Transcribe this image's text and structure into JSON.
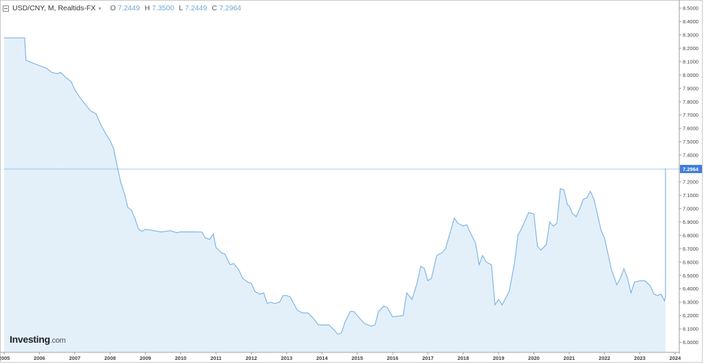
{
  "header": {
    "symbol": "USD/CNY, M, Realtids-FX",
    "dropdown_icon": "chevron-down-icon",
    "open_key": "O",
    "open_val": "7.2449",
    "high_key": "H",
    "high_val": "7.3500",
    "low_key": "L",
    "low_val": "7.2449",
    "close_key": "C",
    "close_val": "7.2964"
  },
  "logo": {
    "brand": "Investing",
    "suffix": ".com"
  },
  "colors": {
    "line": "#7fb4e6",
    "fill": "#e3f0fa",
    "price_line": "#5b9ad6",
    "price_label_bg": "#3f7fd8"
  },
  "chart_data": {
    "type": "area",
    "x_unit": "year",
    "xlim": [
      2005.0,
      2024.0
    ],
    "ylim": [
      5.93,
      8.53
    ],
    "y_ticks": [
      "8.5000",
      "8.4000",
      "8.3000",
      "8.2000",
      "8.1000",
      "8.0000",
      "7.9000",
      "7.8000",
      "7.7000",
      "7.6000",
      "7.5000",
      "7.4000",
      "7.3000",
      "7.2000",
      "7.1000",
      "7.0000",
      "6.9000",
      "6.8000",
      "6.7000",
      "6.6000",
      "6.5000",
      "6.4000",
      "6.3000",
      "6.2000",
      "6.1000",
      "6.0000"
    ],
    "x_ticks": [
      "2005",
      "2006",
      "2007",
      "2008",
      "2009",
      "2010",
      "2011",
      "2012",
      "2013",
      "2014",
      "2015",
      "2016",
      "2017",
      "2018",
      "2019",
      "2020",
      "2021",
      "2022",
      "2023",
      "2024"
    ],
    "last_price": "7.2964",
    "last_price_value": 7.2964,
    "points": [
      [
        2005.0,
        8.277
      ],
      [
        2005.58,
        8.277
      ],
      [
        2005.62,
        8.11
      ],
      [
        2005.8,
        8.09
      ],
      [
        2006.0,
        8.07
      ],
      [
        2006.2,
        8.05
      ],
      [
        2006.35,
        8.02
      ],
      [
        2006.5,
        8.01
      ],
      [
        2006.6,
        8.02
      ],
      [
        2006.75,
        7.98
      ],
      [
        2006.9,
        7.95
      ],
      [
        2007.0,
        7.89
      ],
      [
        2007.15,
        7.83
      ],
      [
        2007.3,
        7.78
      ],
      [
        2007.45,
        7.73
      ],
      [
        2007.6,
        7.71
      ],
      [
        2007.75,
        7.62
      ],
      [
        2007.9,
        7.55
      ],
      [
        2008.0,
        7.51
      ],
      [
        2008.1,
        7.45
      ],
      [
        2008.2,
        7.32
      ],
      [
        2008.3,
        7.2
      ],
      [
        2008.42,
        7.1
      ],
      [
        2008.5,
        7.01
      ],
      [
        2008.6,
        6.99
      ],
      [
        2008.7,
        6.93
      ],
      [
        2008.8,
        6.85
      ],
      [
        2008.9,
        6.83
      ],
      [
        2009.0,
        6.845
      ],
      [
        2009.25,
        6.835
      ],
      [
        2009.45,
        6.825
      ],
      [
        2009.7,
        6.835
      ],
      [
        2009.9,
        6.82
      ],
      [
        2010.0,
        6.826
      ],
      [
        2010.25,
        6.826
      ],
      [
        2010.4,
        6.826
      ],
      [
        2010.6,
        6.825
      ],
      [
        2010.7,
        6.78
      ],
      [
        2010.82,
        6.77
      ],
      [
        2010.92,
        6.81
      ],
      [
        2011.0,
        6.71
      ],
      [
        2011.15,
        6.67
      ],
      [
        2011.25,
        6.66
      ],
      [
        2011.4,
        6.58
      ],
      [
        2011.5,
        6.59
      ],
      [
        2011.65,
        6.54
      ],
      [
        2011.75,
        6.48
      ],
      [
        2011.9,
        6.45
      ],
      [
        2012.0,
        6.44
      ],
      [
        2012.1,
        6.38
      ],
      [
        2012.25,
        6.36
      ],
      [
        2012.35,
        6.37
      ],
      [
        2012.45,
        6.29
      ],
      [
        2012.55,
        6.3
      ],
      [
        2012.65,
        6.29
      ],
      [
        2012.8,
        6.3
      ],
      [
        2012.9,
        6.35
      ],
      [
        2013.0,
        6.35
      ],
      [
        2013.1,
        6.34
      ],
      [
        2013.3,
        6.24
      ],
      [
        2013.45,
        6.22
      ],
      [
        2013.6,
        6.22
      ],
      [
        2013.75,
        6.18
      ],
      [
        2013.9,
        6.13
      ],
      [
        2014.0,
        6.13
      ],
      [
        2014.2,
        6.13
      ],
      [
        2014.35,
        6.09
      ],
      [
        2014.45,
        6.06
      ],
      [
        2014.55,
        6.07
      ],
      [
        2014.65,
        6.15
      ],
      [
        2014.8,
        6.23
      ],
      [
        2014.9,
        6.23
      ],
      [
        2015.0,
        6.2
      ],
      [
        2015.2,
        6.14
      ],
      [
        2015.4,
        6.12
      ],
      [
        2015.5,
        6.13
      ],
      [
        2015.6,
        6.23
      ],
      [
        2015.75,
        6.27
      ],
      [
        2015.85,
        6.26
      ],
      [
        2016.0,
        6.19
      ],
      [
        2016.3,
        6.2
      ],
      [
        2016.4,
        6.37
      ],
      [
        2016.55,
        6.32
      ],
      [
        2016.7,
        6.45
      ],
      [
        2016.8,
        6.57
      ],
      [
        2016.9,
        6.55
      ],
      [
        2017.0,
        6.46
      ],
      [
        2017.1,
        6.48
      ],
      [
        2017.25,
        6.65
      ],
      [
        2017.4,
        6.67
      ],
      [
        2017.5,
        6.7
      ],
      [
        2017.65,
        6.84
      ],
      [
        2017.75,
        6.93
      ],
      [
        2017.85,
        6.89
      ],
      [
        2018.0,
        6.87
      ],
      [
        2018.1,
        6.88
      ],
      [
        2018.2,
        6.82
      ],
      [
        2018.35,
        6.74
      ],
      [
        2018.45,
        6.58
      ],
      [
        2018.55,
        6.65
      ],
      [
        2018.65,
        6.6
      ],
      [
        2018.8,
        6.58
      ],
      [
        2018.9,
        6.28
      ],
      [
        2019.0,
        6.32
      ],
      [
        2019.1,
        6.28
      ],
      [
        2019.3,
        6.38
      ],
      [
        2019.45,
        6.59
      ],
      [
        2019.55,
        6.8
      ],
      [
        2019.65,
        6.85
      ],
      [
        2019.75,
        6.91
      ],
      [
        2019.85,
        6.97
      ],
      [
        2020.0,
        6.96
      ],
      [
        2020.1,
        6.72
      ],
      [
        2020.2,
        6.69
      ],
      [
        2020.35,
        6.73
      ],
      [
        2020.45,
        6.9
      ],
      [
        2020.55,
        6.87
      ],
      [
        2020.65,
        6.89
      ],
      [
        2020.75,
        7.15
      ],
      [
        2020.85,
        7.14
      ],
      [
        2020.95,
        7.03
      ],
      [
        2021.0,
        7.02
      ],
      [
        2021.1,
        6.96
      ],
      [
        2021.2,
        6.94
      ],
      [
        2021.3,
        7.0
      ],
      [
        2021.4,
        7.07
      ],
      [
        2021.5,
        7.08
      ],
      [
        2021.6,
        7.13
      ],
      [
        2021.7,
        7.07
      ],
      [
        2021.8,
        6.96
      ],
      [
        2021.9,
        6.84
      ],
      [
        2022.0,
        6.78
      ],
      [
        2022.1,
        6.66
      ],
      [
        2022.2,
        6.54
      ],
      [
        2022.35,
        6.43
      ],
      [
        2022.45,
        6.48
      ],
      [
        2022.55,
        6.55
      ],
      [
        2022.65,
        6.48
      ],
      [
        2022.75,
        6.37
      ],
      [
        2022.85,
        6.45
      ],
      [
        2023.0,
        6.46
      ],
      [
        2023.15,
        6.46
      ],
      [
        2023.3,
        6.42
      ],
      [
        2023.4,
        6.36
      ],
      [
        2023.5,
        6.35
      ],
      [
        2023.6,
        6.36
      ],
      [
        2023.7,
        6.31
      ],
      [
        2023.8,
        6.35
      ],
      [
        2023.85,
        6.61
      ],
      [
        2023.95,
        6.69
      ],
      [
        2024.05,
        6.79
      ],
      [
        2024.15,
        6.96
      ],
      [
        2024.25,
        7.26
      ],
      [
        2024.3,
        7.3
      ],
      [
        2024.4,
        7.0
      ],
      [
        2024.5,
        6.88
      ],
      [
        2024.6,
        6.75
      ],
      [
        2024.7,
        6.94
      ],
      [
        2024.8,
        6.88
      ],
      [
        2024.9,
        6.94
      ],
      [
        2025.0,
        7.1
      ],
      [
        2025.1,
        7.27
      ],
      [
        2025.2,
        7.14
      ],
      [
        2025.3,
        7.24
      ],
      [
        2025.35,
        7.2964
      ]
    ]
  }
}
